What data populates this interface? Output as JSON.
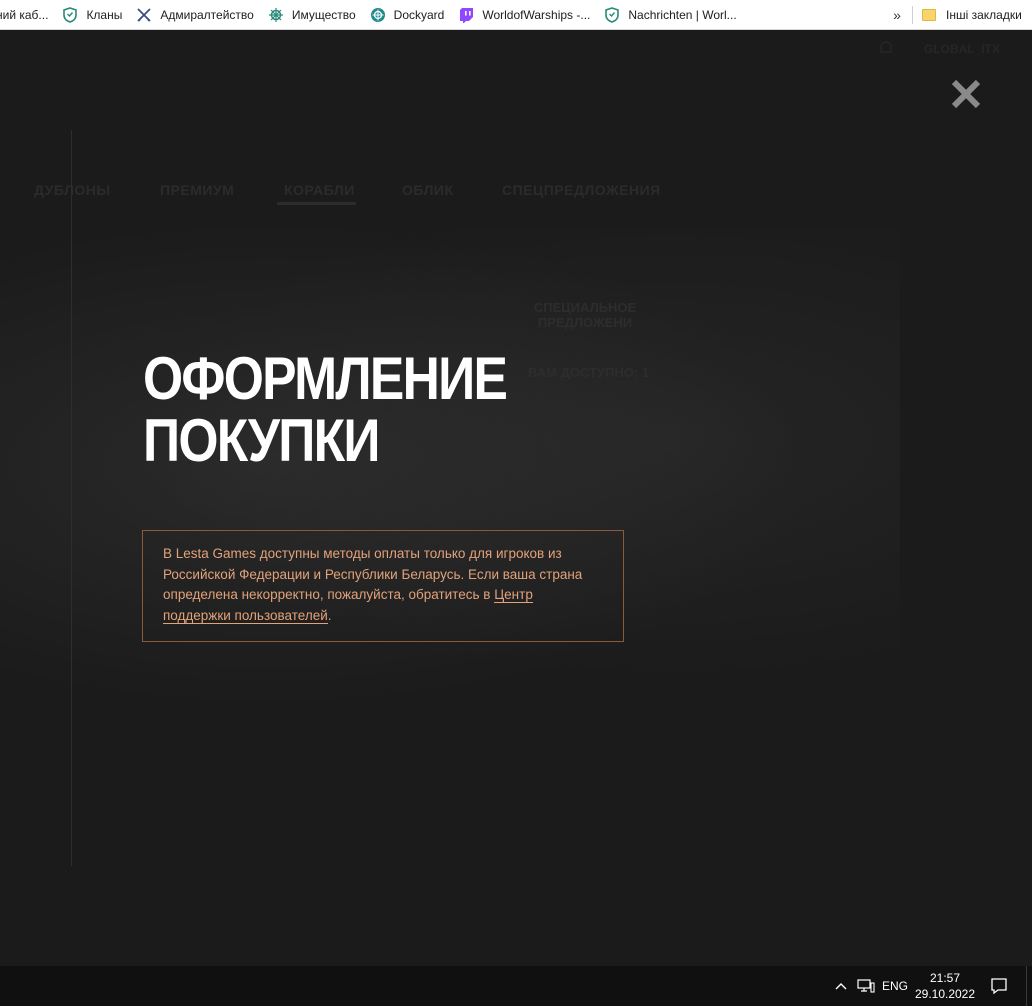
{
  "bookmarks": {
    "items": [
      {
        "label": "ний каб...",
        "icon": "blank"
      },
      {
        "label": "Кланы",
        "icon": "shield-icon"
      },
      {
        "label": "Адмиралтейство",
        "icon": "anchor-cross-icon"
      },
      {
        "label": "Имущество",
        "icon": "ship-wheel-icon"
      },
      {
        "label": "Dockyard",
        "icon": "dockyard-icon"
      },
      {
        "label": "WorldofWarships -...",
        "icon": "twitch-icon"
      },
      {
        "label": "Nachrichten | Worl...",
        "icon": "shield-icon"
      }
    ],
    "overflow": "»",
    "other": "Інші закладки"
  },
  "page": {
    "title_line1": "ОФОРМЛЕНИЕ",
    "title_line2": "ПОКУПКИ",
    "notice_text": "В Lesta Games доступны методы оплаты только для игроков из Российской Федерации и Республики Беларусь. Если ваша страна определена некорректно, пожалуйста, обратитесь в ",
    "notice_link": "Центр поддержки пользователей",
    "notice_end": ".",
    "close_icon": "close-icon",
    "ghost_nav": [
      "ДУБЛОНЫ",
      "ПРЕМИУМ",
      "КОРАБЛИ",
      "ОБЛИК",
      "СПЕЦПРЕДЛОЖЕНИЯ"
    ],
    "ghost_top_right": "GLOBAL_ITX",
    "ghost_special_line1": "СПЕЦИАЛЬНОЕ",
    "ghost_special_line2": "ПРЕДЛОЖЕНИ",
    "ghost_available": "ВАМ ДОСТУПНО: 1"
  },
  "taskbar": {
    "lang": "ENG",
    "time": "21:57",
    "date": "29.10.2022"
  },
  "colors": {
    "accent_text": "#e2a27a",
    "notice_border": "#8a5a3a",
    "background": "#1b1b1b"
  }
}
